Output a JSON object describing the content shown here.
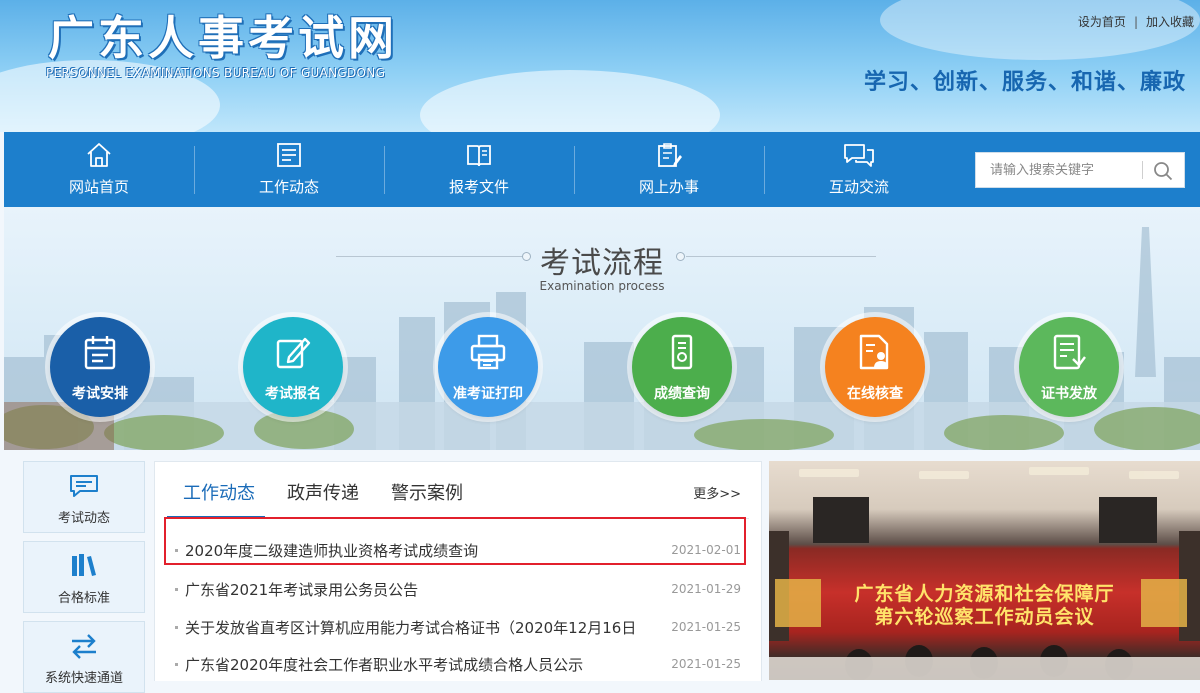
{
  "header": {
    "logo_cn": "广东人事考试网",
    "logo_en": "PERSONNEL EXAMINATIONS BUREAU OF GUANGDONG",
    "links": [
      "设为首页",
      "加入收藏"
    ],
    "link_separator": "|",
    "slogan": "学习、创新、服务、和谐、廉政"
  },
  "nav": {
    "items": [
      {
        "label": "网站首页",
        "icon": "home-icon"
      },
      {
        "label": "工作动态",
        "icon": "newspaper-icon"
      },
      {
        "label": "报考文件",
        "icon": "book-icon"
      },
      {
        "label": "网上办事",
        "icon": "clipboard-edit-icon"
      },
      {
        "label": "互动交流",
        "icon": "chat-bubbles-icon"
      }
    ],
    "search": {
      "placeholder": "请输入搜索关键字",
      "value": ""
    }
  },
  "banner": {
    "title": "考试流程",
    "subtitle": "Examination process",
    "steps": [
      {
        "label": "考试安排",
        "color": "#1a5fa8",
        "icon": "calendar-icon"
      },
      {
        "label": "考试报名",
        "color": "#1fb5c9",
        "icon": "edit-icon"
      },
      {
        "label": "准考证打印",
        "color": "#3d9be9",
        "icon": "printer-icon"
      },
      {
        "label": "成绩查询",
        "color": "#4cae4c",
        "icon": "document-search-icon"
      },
      {
        "label": "在线核查",
        "color": "#f5821f",
        "icon": "user-document-icon"
      },
      {
        "label": "证书发放",
        "color": "#5cb85c",
        "icon": "certificate-icon"
      }
    ]
  },
  "sidebar": {
    "items": [
      {
        "label": "考试动态",
        "icon": "message-icon"
      },
      {
        "label": "合格标准",
        "icon": "books-icon"
      },
      {
        "label": "系统快速通道",
        "icon": "exchange-arrows-icon"
      }
    ]
  },
  "news": {
    "tabs": [
      "工作动态",
      "政声传递",
      "警示案例"
    ],
    "active_tab": 0,
    "more": "更多>>",
    "items": [
      {
        "title": "2020年度二级建造师执业资格考试成绩查询",
        "date": "2021-02-01"
      },
      {
        "title": "广东省2021年考试录用公务员公告",
        "date": "2021-01-29"
      },
      {
        "title": "关于发放省直考区计算机应用能力考试合格证书（2020年12月16日",
        "date": "2021-01-25"
      },
      {
        "title": "广东省2020年度社会工作者职业水平考试成绩合格人员公示",
        "date": "2021-01-25"
      }
    ]
  },
  "photo": {
    "banner_line1": "广东省人力资源和社会保障厅",
    "banner_line2": "第六轮巡察工作动员会议"
  }
}
